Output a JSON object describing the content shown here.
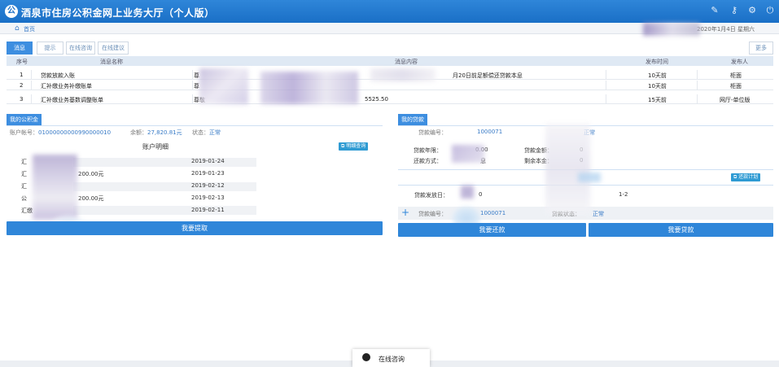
{
  "header": {
    "logo_text": "公",
    "title": "酒泉市住房公积金网上业务大厅（个人版）"
  },
  "breadcrumb": {
    "home": "首页",
    "date": "2020年1月4日 星期六"
  },
  "tabs": [
    "消息",
    "提示",
    "在线咨询",
    "在线建议"
  ],
  "more_label": "更多",
  "table": {
    "headers": [
      "序号",
      "消息名称",
      "消息内容",
      "发布时间",
      "发布人"
    ],
    "rows": [
      {
        "no": "1",
        "name": "贷款放款入账",
        "content_start": "尊",
        "content_end": "月20日前足额偿还贷款本息",
        "time": "10天前",
        "publisher": "柜面"
      },
      {
        "no": "2",
        "name": "汇补缴业务补缴账单",
        "content_start": "尊",
        "content_end": "",
        "time": "10天前",
        "publisher": "柜面"
      },
      {
        "no": "3",
        "name": "汇补缴业务基数调整账单",
        "content_start": "尊敬",
        "content_end": "5525.50",
        "time": "15天前",
        "publisher": "网厅-单位版"
      }
    ]
  },
  "left_panel": {
    "tag": "我的公积金",
    "account_label": "账户帐号：",
    "account_value": "01000000000990000010",
    "balance_label": "余额：",
    "balance_value": "27,820.81元",
    "status_label": "状态：",
    "status_value": "正常",
    "section_title": "账户明细",
    "detail_button": "明细查询",
    "entries": [
      {
        "type": "汇",
        "amount": "",
        "date": "2019-01-24"
      },
      {
        "type": "汇",
        "amount": "200.00元",
        "date": "2019-01-23"
      },
      {
        "type": "汇",
        "amount": "",
        "date": "2019-02-12"
      },
      {
        "type": "公",
        "amount": "200.00元",
        "date": "2019-02-13"
      },
      {
        "type": "汇缴",
        "amount": "",
        "date": "2019-02-11"
      }
    ],
    "action_button": "我要提取"
  },
  "right_panel": {
    "tag": "我的贷款",
    "contract_label": "贷款编号：",
    "contract_value": "1000071",
    "status_value": "正常",
    "term_label": "贷款年限：",
    "term_value": "0.00",
    "loan_amount_label": "贷款金额：",
    "loan_amount_value": "0",
    "repay_label": "还款方式：",
    "repay_value": "息",
    "remaining_label": "剩余本金：",
    "remaining_value": "0",
    "repay_plan_button": "还款计划",
    "date_label": "贷款发放日：",
    "date_value": "1-2",
    "bottom_contract_label": "贷款编号：",
    "bottom_contract_value": "1000071",
    "bottom_status_label": "贷款状态：",
    "bottom_status_value": "正常",
    "button_left": "我要还款",
    "button_right": "我要贷款"
  },
  "online": {
    "label": "在线咨询"
  }
}
